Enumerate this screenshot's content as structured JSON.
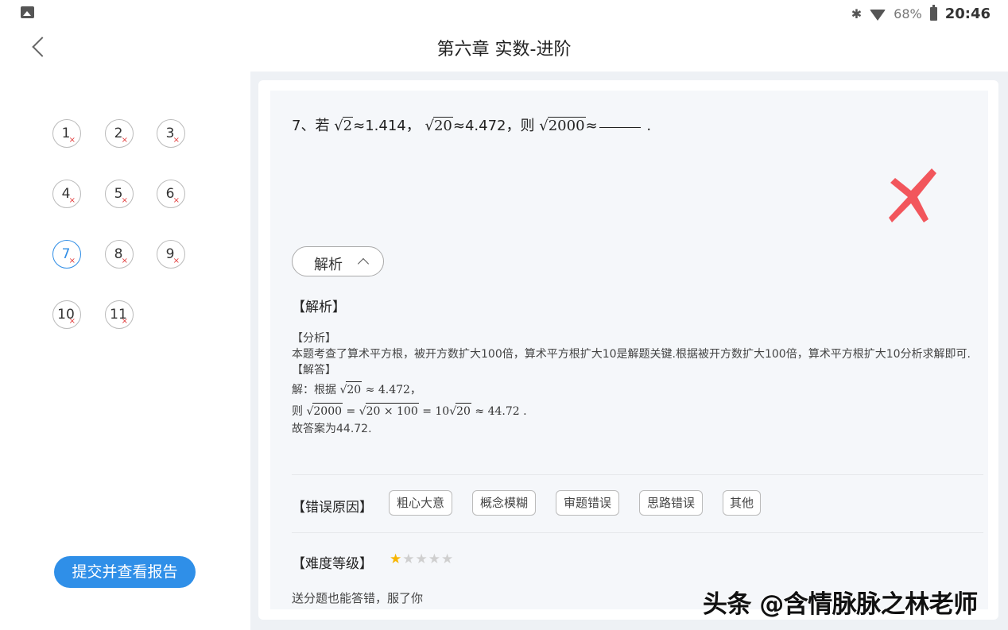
{
  "status_bar": {
    "bluetooth_icon": "bluetooth-icon",
    "battery_percent": "68%",
    "time": "20:46"
  },
  "header": {
    "title": "第六章 实数-进阶"
  },
  "questions": [
    {
      "num": "1",
      "status": "wrong"
    },
    {
      "num": "2",
      "status": "wrong"
    },
    {
      "num": "3",
      "status": "wrong"
    },
    {
      "num": "4",
      "status": "wrong"
    },
    {
      "num": "5",
      "status": "wrong"
    },
    {
      "num": "6",
      "status": "wrong"
    },
    {
      "num": "7",
      "status": "wrong",
      "selected": true
    },
    {
      "num": "8",
      "status": "wrong"
    },
    {
      "num": "9",
      "status": "wrong"
    },
    {
      "num": "10",
      "status": "wrong"
    },
    {
      "num": "11",
      "status": "wrong"
    }
  ],
  "wrong_mark": "×",
  "submit_label": "提交并查看报告",
  "question": {
    "prefix": "7、若",
    "r1": "2",
    "v1": "≈1.414，",
    "r2": "20",
    "v2": "≈4.472，则",
    "r3": "2000",
    "v3": "≈",
    "end": "."
  },
  "analysis_toggle": "解析",
  "analysis_heading": "【解析】",
  "analysis": {
    "fenxi_label": "【分析】",
    "fenxi_text": "本题考查了算术平方根，被开方数扩大100倍，算术平方根扩大10是解题关键.根据被开方数扩大100倍，算术平方根扩大10分析求解即可.",
    "jieda_label": "【解答】",
    "line1_prefix": "解：根据",
    "line1_rad": "20",
    "line1_rest": "≈ 4.472，",
    "line2_prefix": "则",
    "line2_rad1": "2000",
    "line2_eq1": "=",
    "line2_rad2": "20 × 100",
    "line2_eq2": "= 10",
    "line2_rad3": "20",
    "line2_rest": "≈ 44.72 .",
    "answer": "故答案为44.72."
  },
  "error_reason": {
    "label": "【错误原因】",
    "tags": [
      "粗心大意",
      "概念模糊",
      "审题错误",
      "思路错误",
      "其他"
    ]
  },
  "difficulty": {
    "label": "【难度等级】",
    "rating": 1,
    "max": 5
  },
  "comment": "送分题也能答错，服了你",
  "watermark": "头条 @含情脉脉之林老师",
  "colors": {
    "accent": "#2f8fe8",
    "wrong": "#e23a3a",
    "star": "#f7b500"
  }
}
